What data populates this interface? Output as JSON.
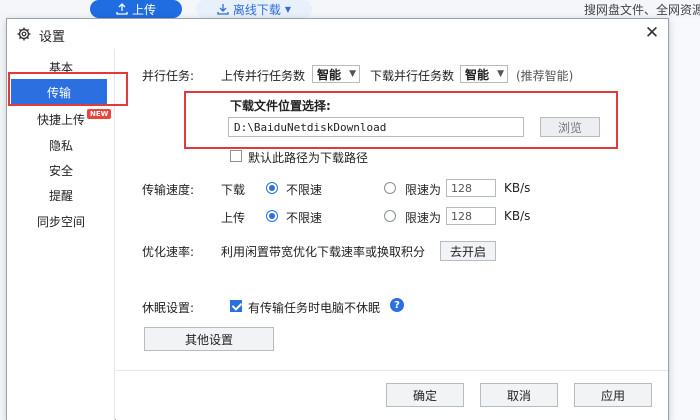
{
  "background": {
    "upload_label": "上传",
    "offline_label": "离线下载",
    "search_text": "搜网盘文件、全网资源"
  },
  "dialog": {
    "title": "设置"
  },
  "sidebar": {
    "items": [
      {
        "label": "基本"
      },
      {
        "label": "传输",
        "active": true
      },
      {
        "label": "快捷上传",
        "badge": "NEW"
      },
      {
        "label": "隐私"
      },
      {
        "label": "安全"
      },
      {
        "label": "提醒"
      },
      {
        "label": "同步空间"
      }
    ]
  },
  "tasks": {
    "label": "并行任务:",
    "upload_label": "上传并行任务数",
    "upload_value": "智能",
    "download_label": "下载并行任务数",
    "download_value": "智能",
    "hint": "(推荐智能)"
  },
  "download_location": {
    "label": "下载文件位置选择:",
    "path": "D:\\BaiduNetdiskDownload",
    "browse_label": "浏览",
    "default_checkbox_label": "默认此路径为下载路径",
    "default_checked": false
  },
  "speed": {
    "label": "传输速度:",
    "rows": [
      {
        "direction": "下载",
        "unlimited_label": "不限速",
        "limit_label": "限速为",
        "limit_value": "128",
        "unit": "KB/s",
        "unlimited_selected": true
      },
      {
        "direction": "上传",
        "unlimited_label": "不限速",
        "limit_label": "限速为",
        "limit_value": "128",
        "unit": "KB/s",
        "unlimited_selected": true
      }
    ]
  },
  "optimize": {
    "label": "优化速率:",
    "text": "利用闲置带宽优化下载速率或换取积分",
    "button_label": "去开启"
  },
  "sleep": {
    "label": "休眠设置:",
    "checkbox_label": "有传输任务时电脑不休眠",
    "checked": true
  },
  "other_settings_label": "其他设置",
  "footer": {
    "ok_label": "确定",
    "cancel_label": "取消",
    "apply_label": "应用"
  },
  "colors": {
    "accent": "#2b6fe0",
    "highlight": "#e23a3a"
  }
}
